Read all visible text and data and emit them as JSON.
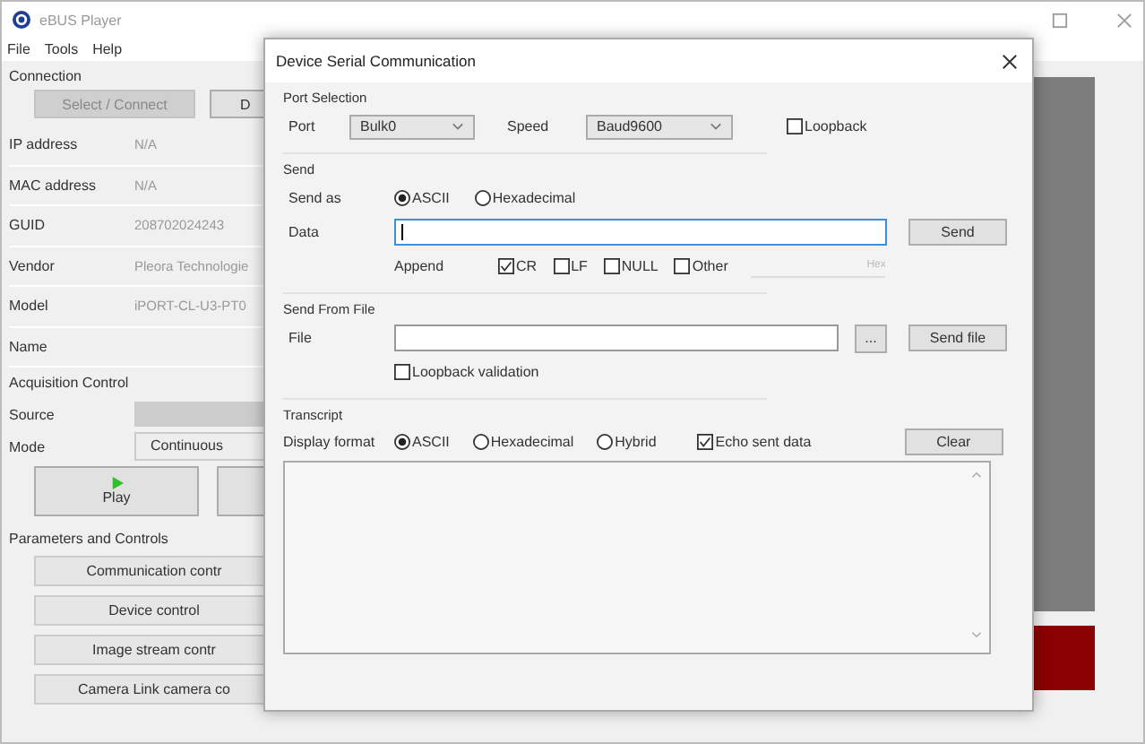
{
  "app": {
    "title": "eBUS Player",
    "menu": [
      "File",
      "Tools",
      "Help"
    ]
  },
  "connection": {
    "heading": "Connection",
    "buttons": [
      {
        "label": "Select / Connect",
        "disabled": true
      },
      {
        "label": "D",
        "disabled": false
      }
    ],
    "fields": [
      {
        "label": "IP address",
        "value": "N/A"
      },
      {
        "label": "MAC address",
        "value": "N/A"
      },
      {
        "label": "GUID",
        "value": "208702024243"
      },
      {
        "label": "Vendor",
        "value": "Pleora Technologie"
      },
      {
        "label": "Model",
        "value": "iPORT-CL-U3-PT0"
      },
      {
        "label": "Name"
      }
    ]
  },
  "acquisition": {
    "heading": "Acquisition Control",
    "source_label": "Source",
    "mode_label": "Mode",
    "mode_value": "Continuous",
    "play_label": "Play"
  },
  "parameters": {
    "heading": "Parameters and Controls",
    "buttons": [
      "Communication contr",
      "Device control",
      "Image stream contr",
      "Camera Link camera co"
    ]
  },
  "dialog": {
    "title": "Device Serial Communication",
    "port_selection": {
      "heading": "Port Selection",
      "port_label": "Port",
      "port_value": "Bulk0",
      "speed_label": "Speed",
      "speed_value": "Baud9600",
      "loopback": {
        "label": "Loopback",
        "checked": false
      }
    },
    "send": {
      "heading": "Send",
      "send_as_label": "Send as",
      "formats": [
        {
          "label": "ASCII",
          "selected": true
        },
        {
          "label": "Hexadecimal",
          "selected": false
        }
      ],
      "data_label": "Data",
      "send_button": "Send",
      "append_label": "Append",
      "append": [
        {
          "label": "CR",
          "checked": true
        },
        {
          "label": "LF",
          "checked": false
        },
        {
          "label": "NULL",
          "checked": false
        },
        {
          "label": "Other",
          "checked": false
        }
      ],
      "other_placeholder": "Hex"
    },
    "send_from_file": {
      "heading": "Send From File",
      "file_label": "File",
      "browse_button": "...",
      "send_file_button": "Send file",
      "loopback_validation": {
        "label": "Loopback validation",
        "checked": false
      }
    },
    "transcript": {
      "heading": "Transcript",
      "display_format_label": "Display format",
      "formats": [
        {
          "label": "ASCII",
          "selected": true
        },
        {
          "label": "Hexadecimal",
          "selected": false
        },
        {
          "label": "Hybrid",
          "selected": false
        }
      ],
      "echo": {
        "label": "Echo sent data",
        "checked": true
      },
      "clear_button": "Clear"
    }
  }
}
